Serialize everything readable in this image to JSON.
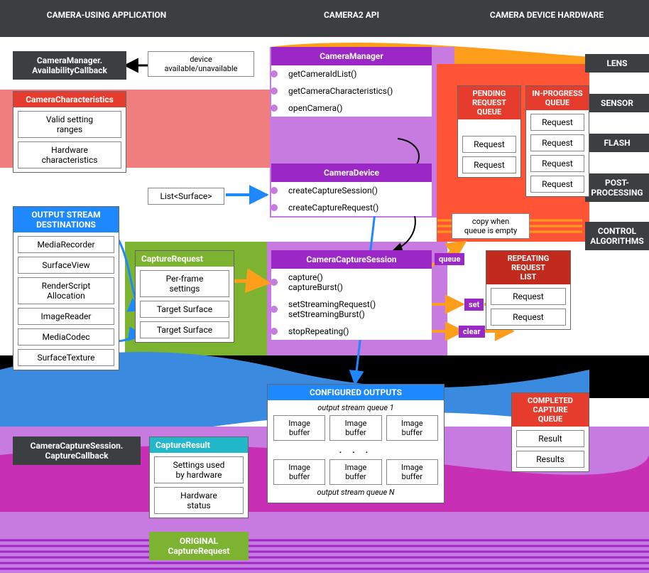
{
  "columns": {
    "left": "CAMERA-USING APPLICATION",
    "mid": "CAMERA2 API",
    "right": "CAMERA DEVICE HARDWARE"
  },
  "colors": {
    "darkgray": "#3b3f42",
    "purple": "#9c27c7",
    "purpleLt": "#c77ae0",
    "orange": "#ff9e1b",
    "orangeRed": "#ff5436",
    "red": "#e53c2e",
    "redDk": "#c22a1d",
    "salmon": "#f07e7e",
    "green": "#7cb330",
    "blue": "#3a8be0",
    "blueBright": "#1e88ff",
    "cyan": "#22b7c9",
    "magenta": "#c72fb5",
    "black": "#000"
  },
  "hw": [
    "LENS",
    "SENSOR",
    "FLASH",
    "POST-\nPROCESSING",
    "CONTROL\nALGORITHMS"
  ],
  "availCb": "CameraManager.\nAvailabilityCallback",
  "availNote": "device\navailable/unavailable",
  "camChar": {
    "title": "CameraCharacteristics",
    "items": [
      "Valid setting\nranges",
      "Hardware\ncharacteristics"
    ]
  },
  "outDest": {
    "title": "OUTPUT STREAM\nDESTINATIONS",
    "items": [
      "MediaRecorder",
      "SurfaceView",
      "RenderScript\nAllocation",
      "ImageReader",
      "MediaCodec",
      "SurfaceTexture"
    ]
  },
  "listSurface": "List<Surface>",
  "captureReq": {
    "title": "CaptureRequest",
    "items": [
      "Per-frame\nsettings",
      "Target Surface",
      "Target Surface"
    ]
  },
  "captureRes": {
    "title": "CaptureResult",
    "items": [
      "Settings used\nby hardware",
      "Hardware\nstatus"
    ]
  },
  "origReq": "ORIGINAL\nCaptureRequest",
  "ccsCb": "CameraCaptureSession.\nCaptureCallback",
  "api": {
    "cameraManager": {
      "title": "CameraManager",
      "methods": [
        "getCameraIdList()",
        "getCameraCharacteristics()",
        "openCamera()"
      ]
    },
    "cameraDevice": {
      "title": "CameraDevice",
      "methods": [
        "createCaptureSession()",
        "createCaptureRequest()"
      ]
    },
    "cameraCaptureSession": {
      "title": "CameraCaptureSession",
      "methods": [
        "capture()\ncaptureBurst()",
        "setStreamingRequest()\nsetStreamingBurst()",
        "stopRepeating()"
      ]
    }
  },
  "tags": {
    "queue": "queue",
    "set": "set",
    "clear": "clear"
  },
  "pendingQ": {
    "title": "PENDING\nREQUEST\nQUEUE",
    "items": [
      "Request",
      "Request"
    ]
  },
  "inProgQ": {
    "title": "IN-PROGRESS\nQUEUE",
    "items": [
      "Request",
      "Request",
      "Request",
      "Request"
    ]
  },
  "copyNote": "copy when\nqueue is empty",
  "repeatList": {
    "title": "REPEATING\nREQUEST\nLIST",
    "items": [
      "Request",
      "Request"
    ]
  },
  "confOut": {
    "title": "CONFIGURED OUTPUTS",
    "q1": "output stream queue 1",
    "qn": "output stream queue N",
    "cell": "Image\nbuffer",
    "ell": ". . ."
  },
  "compQ": {
    "title": "COMPLETED\nCAPTURE\nQUEUE",
    "items": [
      "Result",
      "Results"
    ]
  }
}
